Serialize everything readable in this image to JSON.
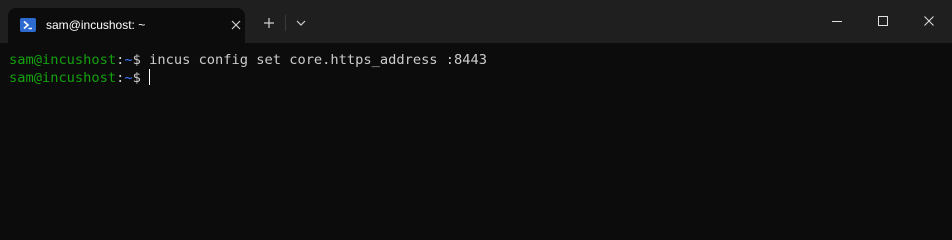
{
  "tab": {
    "icon": "powershell-icon",
    "title": "sam@incushost: ~",
    "close_icon": "close-icon"
  },
  "toolbar": {
    "new_tab_icon": "plus-icon",
    "dropdown_icon": "chevron-down-icon"
  },
  "window_controls": {
    "minimize_icon": "minimize-icon",
    "maximize_icon": "maximize-icon",
    "close_icon": "close-icon"
  },
  "terminal": {
    "lines": [
      {
        "user_host": "sam@incushost",
        "sep": ":",
        "path": "~",
        "prompt": "$ ",
        "command": "incus config set core.https_address :8443"
      },
      {
        "user_host": "sam@incushost",
        "sep": ":",
        "path": "~",
        "prompt": "$",
        "command": ""
      }
    ]
  },
  "colors": {
    "background": "#0c0c0c",
    "titlebar": "#1f1f1f",
    "user_host": "#13a10e",
    "path": "#3b78ff",
    "text": "#cccccc"
  }
}
